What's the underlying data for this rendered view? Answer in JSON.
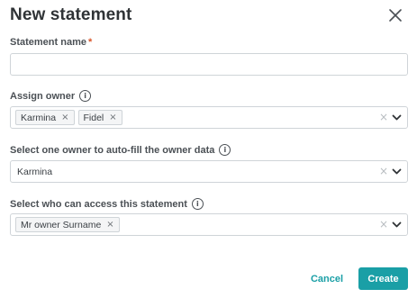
{
  "dialog": {
    "title": "New statement"
  },
  "fields": {
    "statement_name": {
      "label": "Statement name",
      "required_mark": "*",
      "value": "",
      "placeholder": ""
    },
    "assign_owner": {
      "label": "Assign owner",
      "chips": [
        "Karmina",
        "Fidel"
      ]
    },
    "autofill_owner": {
      "label": "Select one owner to auto-fill the owner data",
      "value": "Karmina"
    },
    "access": {
      "label": "Select who can access this statement",
      "chips": [
        "Mr owner Surname"
      ]
    }
  },
  "icons": {
    "info": "i",
    "remove": "×",
    "clear": "×"
  },
  "actions": {
    "cancel_label": "Cancel",
    "create_label": "Create"
  },
  "colors": {
    "accent": "#1a9fa6",
    "required": "#d9562a",
    "border": "#cfd4d8"
  }
}
